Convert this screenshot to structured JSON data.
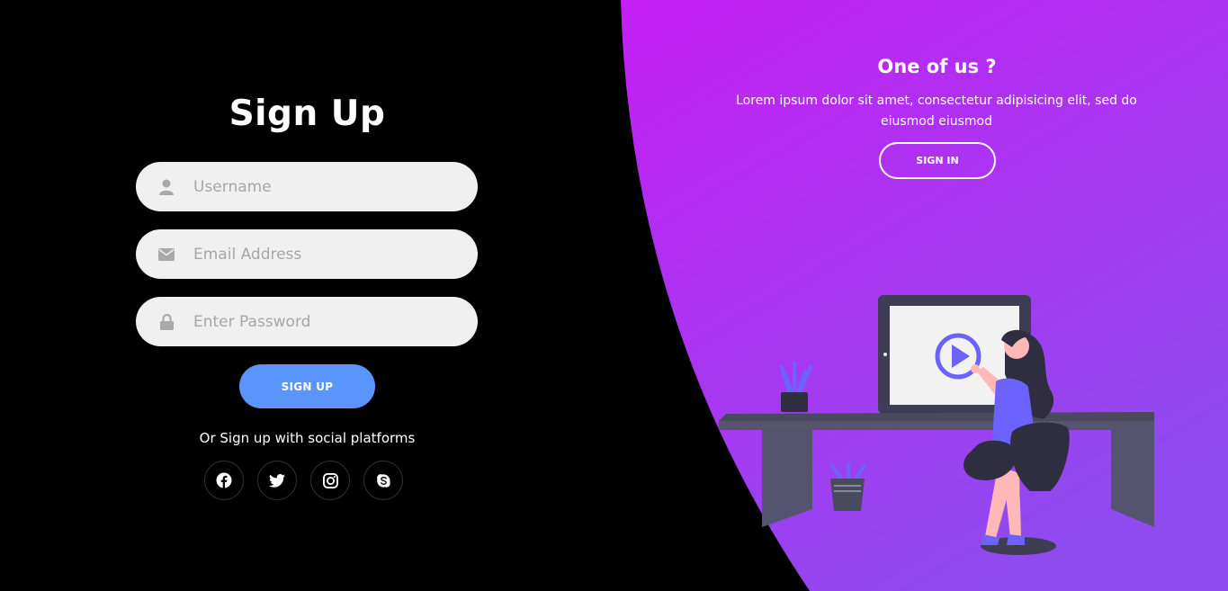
{
  "signup": {
    "title": "Sign Up",
    "username_placeholder": "Username",
    "email_placeholder": "Email Address",
    "password_placeholder": "Enter Password",
    "submit_label": "SIGN UP",
    "social_text": "Or Sign up with social platforms",
    "socials": [
      {
        "icon": "facebook-icon"
      },
      {
        "icon": "twitter-icon"
      },
      {
        "icon": "instagram-icon"
      },
      {
        "icon": "skype-icon"
      }
    ]
  },
  "panel": {
    "title": "One of us ?",
    "text": "Lorem ipsum dolor sit amet, consectetur adipisicing elit, sed do eiusmod eiusmod",
    "button_label": "SIGN IN"
  },
  "colors": {
    "accent": "#5995fd",
    "gradient_top": "#c51ff3",
    "gradient_bottom": "#8f4bf0",
    "left_background": "#000000"
  }
}
